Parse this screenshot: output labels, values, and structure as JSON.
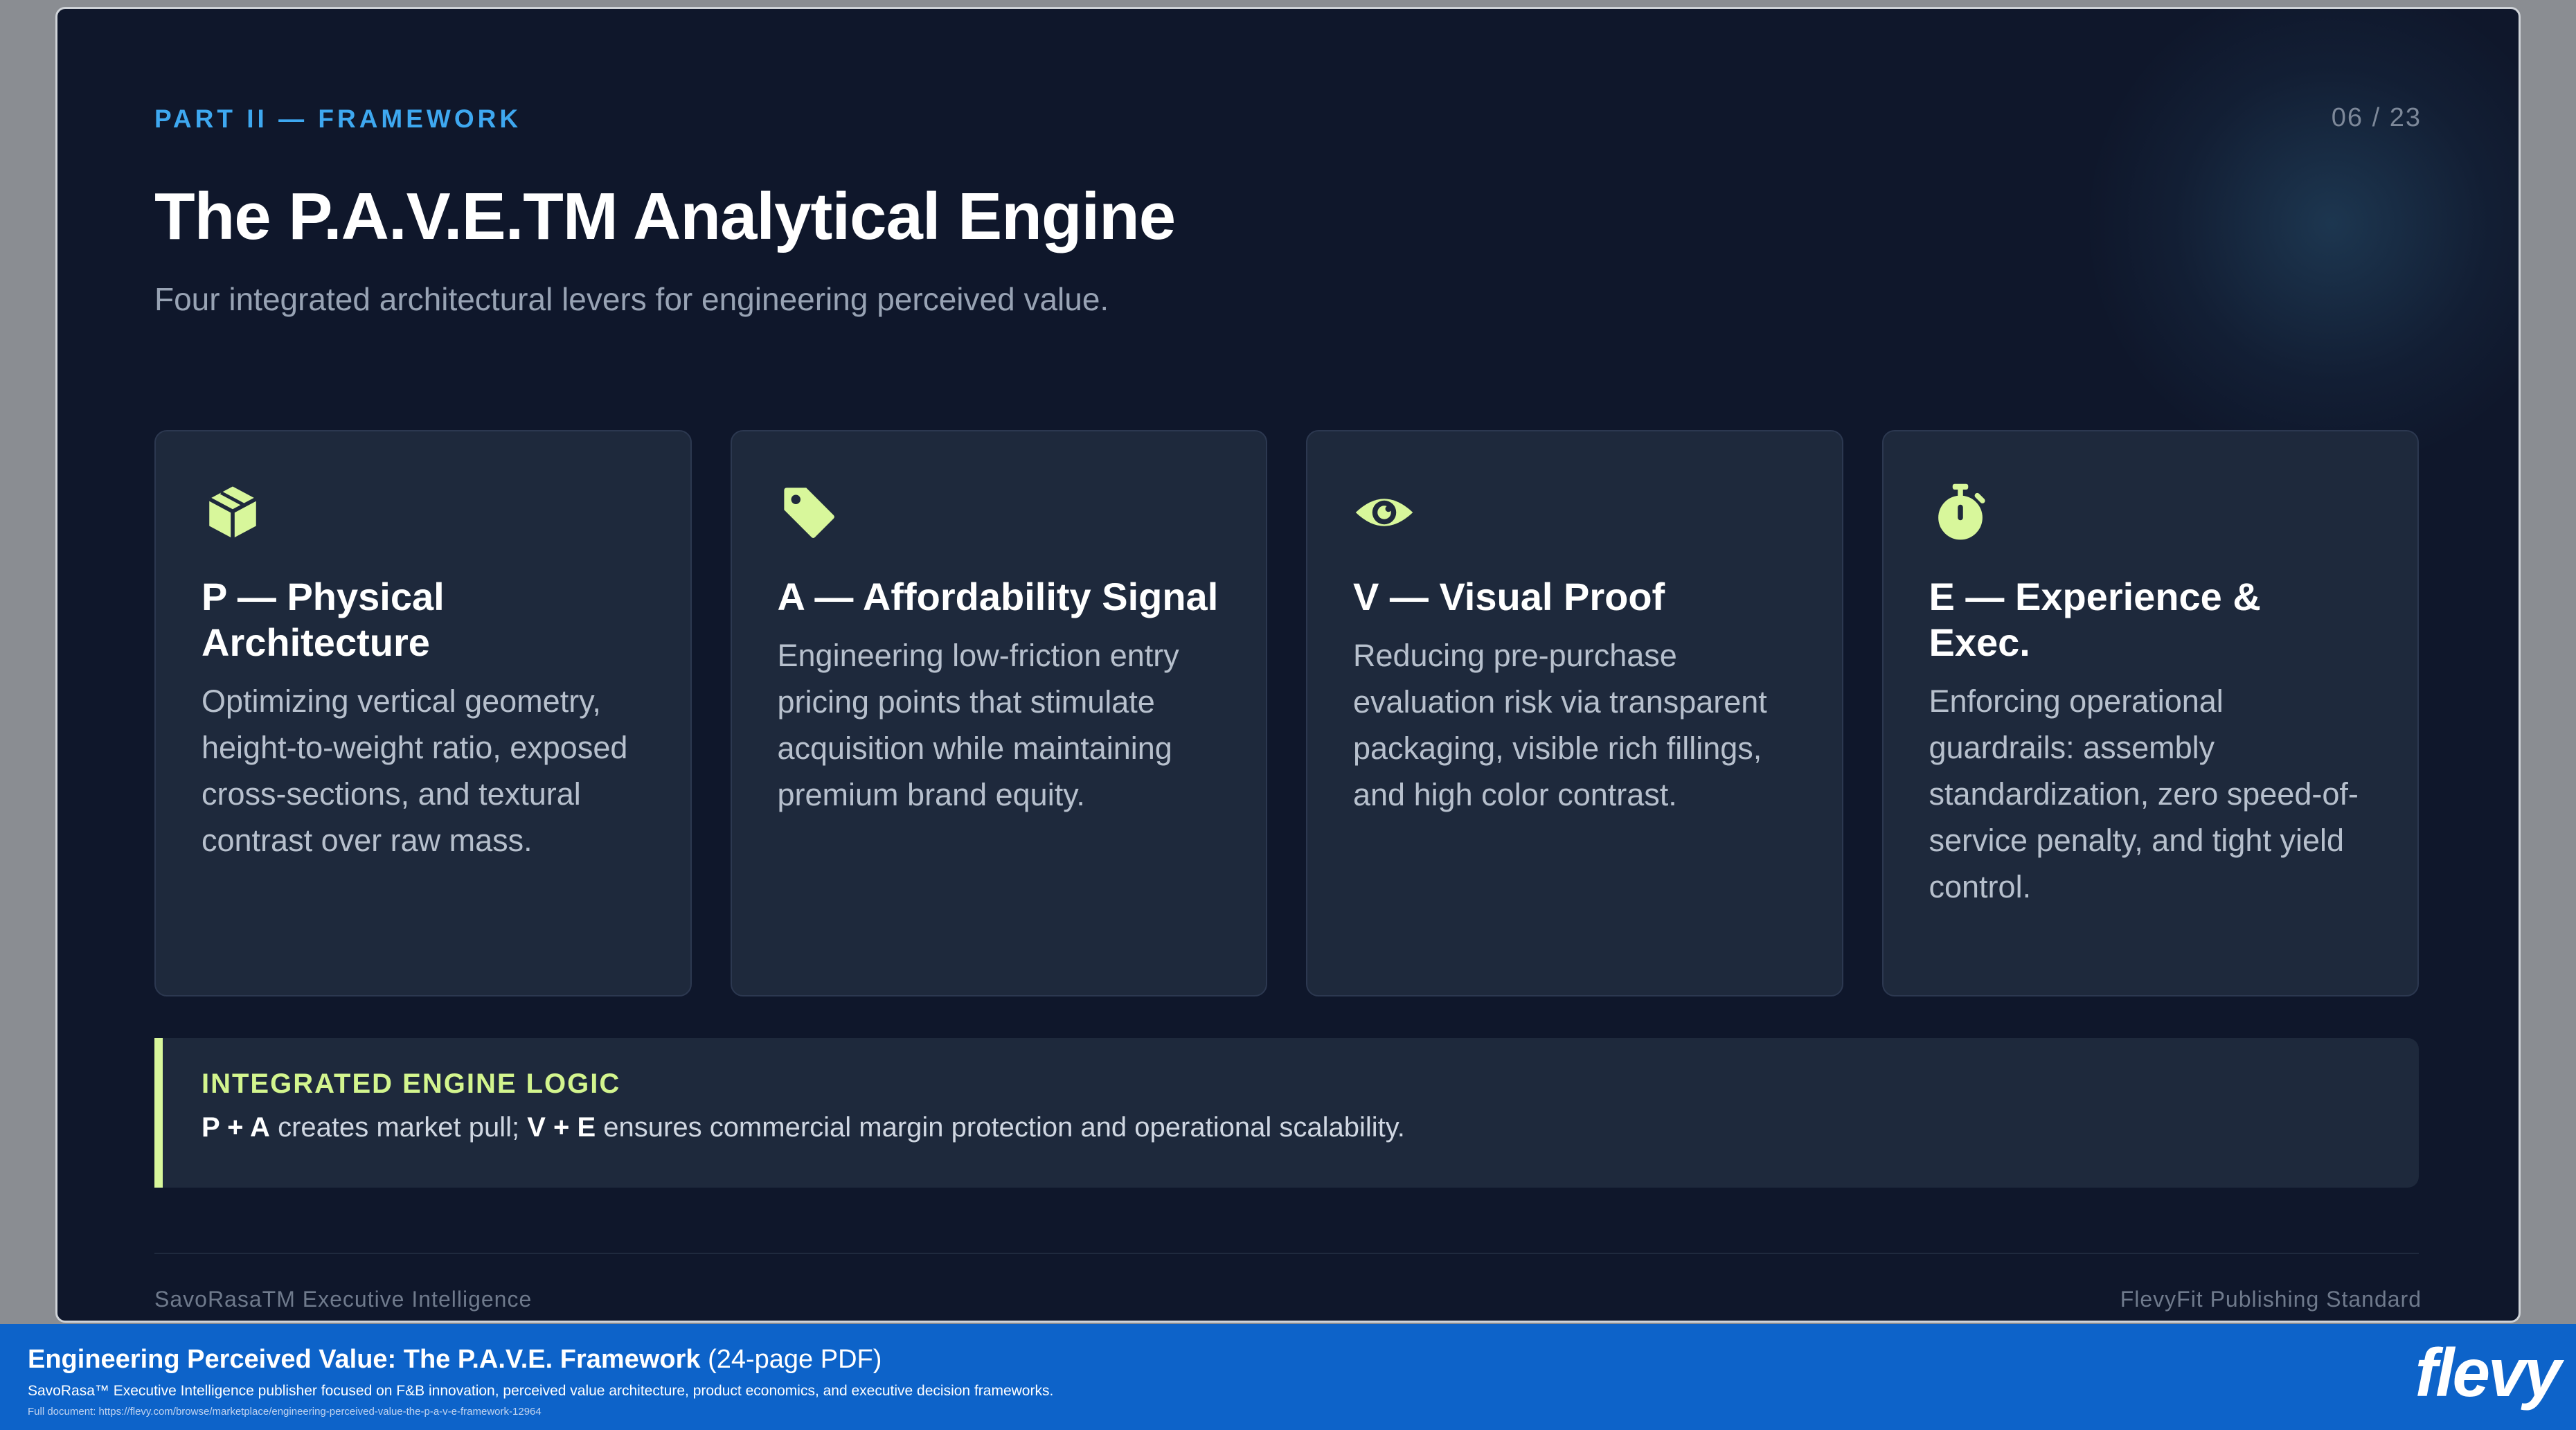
{
  "slide": {
    "kicker": "PART II — FRAMEWORK",
    "page_number": "06 / 23",
    "title": "The P.A.V.E.TM Analytical Engine",
    "subtitle": "Four integrated architectural levers for engineering perceived value."
  },
  "cards": [
    {
      "icon": "cube-icon",
      "title": "P — Physical Architecture",
      "description": "Optimizing vertical geometry, height-to-weight ratio, exposed cross-sections, and textural contrast over raw mass."
    },
    {
      "icon": "tag-icon",
      "title": "A — Affordability Signal",
      "description": "Engineering low-friction entry pricing points that stimulate acquisition while maintaining premium brand equity."
    },
    {
      "icon": "eye-icon",
      "title": "V — Visual Proof",
      "description": "Reducing pre-purchase evaluation risk via transparent packaging, visible rich fillings, and high color contrast."
    },
    {
      "icon": "stopwatch-icon",
      "title": "E — Experience & Exec.",
      "description": "Enforcing operational guardrails: assembly standardization, zero speed-of-service penalty, and tight yield control."
    }
  ],
  "logic": {
    "title": "INTEGRATED ENGINE LOGIC",
    "part1_bold": "P + A",
    "part1_text": " creates market pull; ",
    "part2_bold": "V + E",
    "part2_text": " ensures commercial margin protection and operational scalability."
  },
  "footer": {
    "left": "SavoRasaTM Executive Intelligence",
    "right": "FlevyFit Publishing Standard"
  },
  "banner": {
    "title": "Engineering Perceived Value: The P.A.V.E. Framework",
    "title_suffix": " (24-page PDF)",
    "description": "SavoRasa™ Executive Intelligence publisher focused on F&B innovation, perceived value architecture, product economics, and executive decision frameworks.",
    "link": "Full document: https://flevy.com/browse/marketplace/engineering-perceived-value-the-p-a-v-e-framework-12964",
    "logo": "flevy"
  },
  "colors": {
    "slide_bg": "#0f172b",
    "card_bg": "#1e293c",
    "accent_lime": "#d8f79b",
    "kicker_blue": "#3ea8f0",
    "banner_blue": "#0d63c9"
  }
}
